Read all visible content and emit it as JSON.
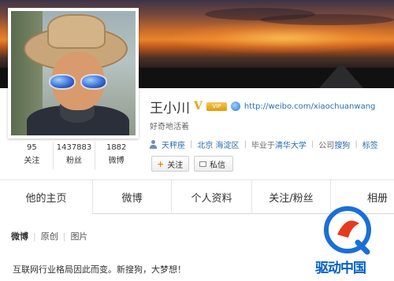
{
  "profile": {
    "name": "王小川",
    "verified_mark": "V",
    "member_badge": "VIP",
    "home_link": "http://weibo.com/xiaochuanwang",
    "bio": "好奇地活着",
    "info": {
      "zodiac": "天秤座",
      "location": "北京 海淀区",
      "school_prefix": "毕业于",
      "school": "清华大学",
      "company_prefix": "公司",
      "company": "搜狗",
      "tags_partial": "标签"
    }
  },
  "stats": [
    {
      "value": "95",
      "label": "关注"
    },
    {
      "value": "1437883",
      "label": "粉丝"
    },
    {
      "value": "1882",
      "label": "微博"
    }
  ],
  "actions": {
    "follow_label": "关注",
    "message_label": "私信"
  },
  "tabs": [
    {
      "label": "他的主页"
    },
    {
      "label": "微博"
    },
    {
      "label": "个人资料"
    },
    {
      "label": "关注/粉丝"
    },
    {
      "label": "相册"
    }
  ],
  "subnav": [
    {
      "label": "微博"
    },
    {
      "label": "原创"
    },
    {
      "label": "图片"
    }
  ],
  "post": {
    "text": "互联网行业格局因此而变。新搜狗，大梦想！"
  },
  "watermark": {
    "text": "驱动中国"
  },
  "icons": {
    "verified": "verified-v-icon",
    "link": "globe-icon",
    "person": "person-icon",
    "follow": "plus-icon",
    "message": "mail-icon"
  }
}
